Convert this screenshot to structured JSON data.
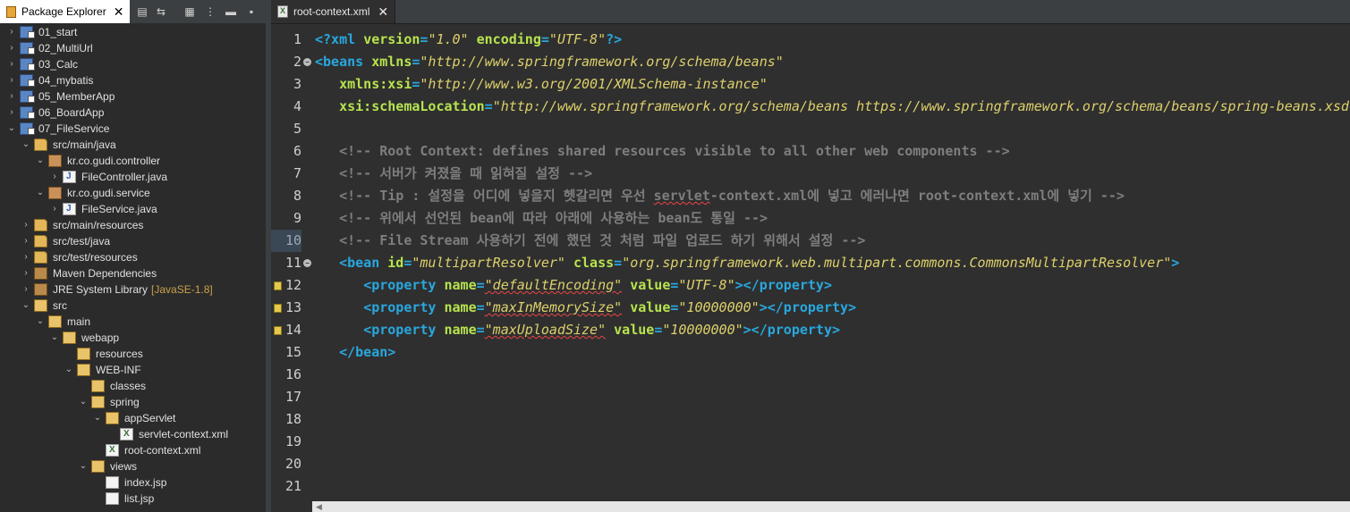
{
  "explorer": {
    "tab_label": "Package Explorer",
    "tree": [
      {
        "label": "01_start",
        "depth": 0,
        "twisty": ">",
        "icon": "project-icon"
      },
      {
        "label": "02_MultiUrl",
        "depth": 0,
        "twisty": ">",
        "icon": "project-icon"
      },
      {
        "label": "03_Calc",
        "depth": 0,
        "twisty": ">",
        "icon": "project-icon"
      },
      {
        "label": "04_mybatis",
        "depth": 0,
        "twisty": ">",
        "icon": "project-icon"
      },
      {
        "label": "05_MemberApp",
        "depth": 0,
        "twisty": ">",
        "icon": "project-icon"
      },
      {
        "label": "06_BoardApp",
        "depth": 0,
        "twisty": ">",
        "icon": "project-icon"
      },
      {
        "label": "07_FileService",
        "depth": 0,
        "twisty": "v",
        "icon": "project-icon"
      },
      {
        "label": "src/main/java",
        "depth": 1,
        "twisty": "v",
        "icon": "source-folder-icon"
      },
      {
        "label": "kr.co.gudi.controller",
        "depth": 2,
        "twisty": "v",
        "icon": "package-icon"
      },
      {
        "label": "FileController.java",
        "depth": 3,
        "twisty": ">",
        "icon": "java-file-icon"
      },
      {
        "label": "kr.co.gudi.service",
        "depth": 2,
        "twisty": "v",
        "icon": "package-icon"
      },
      {
        "label": "FileService.java",
        "depth": 3,
        "twisty": ">",
        "icon": "java-file-icon"
      },
      {
        "label": "src/main/resources",
        "depth": 1,
        "twisty": ">",
        "icon": "source-folder-icon"
      },
      {
        "label": "src/test/java",
        "depth": 1,
        "twisty": ">",
        "icon": "source-folder-icon"
      },
      {
        "label": "src/test/resources",
        "depth": 1,
        "twisty": ">",
        "icon": "source-folder-icon"
      },
      {
        "label": "Maven Dependencies",
        "depth": 1,
        "twisty": ">",
        "icon": "library-icon"
      },
      {
        "label": "JRE System Library",
        "decoration": "[JavaSE-1.8]",
        "depth": 1,
        "twisty": ">",
        "icon": "library-icon"
      },
      {
        "label": "src",
        "depth": 1,
        "twisty": "v",
        "icon": "folder-icon"
      },
      {
        "label": "main",
        "depth": 2,
        "twisty": "v",
        "icon": "folder-icon"
      },
      {
        "label": "webapp",
        "depth": 3,
        "twisty": "v",
        "icon": "folder-icon"
      },
      {
        "label": "resources",
        "depth": 4,
        "twisty": "",
        "icon": "folder-icon"
      },
      {
        "label": "WEB-INF",
        "depth": 4,
        "twisty": "v",
        "icon": "folder-icon"
      },
      {
        "label": "classes",
        "depth": 5,
        "twisty": "",
        "icon": "folder-icon"
      },
      {
        "label": "spring",
        "depth": 5,
        "twisty": "v",
        "icon": "folder-icon"
      },
      {
        "label": "appServlet",
        "depth": 6,
        "twisty": "v",
        "icon": "folder-icon"
      },
      {
        "label": "servlet-context.xml",
        "depth": 7,
        "twisty": "",
        "icon": "xml-file-icon"
      },
      {
        "label": "root-context.xml",
        "depth": 6,
        "twisty": "",
        "icon": "xml-file-icon"
      },
      {
        "label": "views",
        "depth": 5,
        "twisty": "v",
        "icon": "folder-icon"
      },
      {
        "label": "index.jsp",
        "depth": 6,
        "twisty": "",
        "icon": "jsp-file-icon"
      },
      {
        "label": "list.jsp",
        "depth": 6,
        "twisty": "",
        "icon": "jsp-file-icon"
      }
    ]
  },
  "editor": {
    "tab_label": "root-context.xml",
    "current_line": 10,
    "lines": [
      {
        "n": "1",
        "parts": [
          [
            "tag",
            "<?xml "
          ],
          [
            "attr",
            "version"
          ],
          [
            "tag",
            "="
          ],
          [
            "val",
            "\"1.0\""
          ],
          [
            "tag",
            " "
          ],
          [
            "attr",
            "encoding"
          ],
          [
            "tag",
            "="
          ],
          [
            "val",
            "\"UTF-8\""
          ],
          [
            "tag",
            "?>"
          ]
        ]
      },
      {
        "n": "2",
        "fold": true,
        "parts": [
          [
            "tag",
            "<beans "
          ],
          [
            "attr",
            "xmlns"
          ],
          [
            "tag",
            "="
          ],
          [
            "val",
            "\"http://www.springframework.org/schema/beans\""
          ]
        ]
      },
      {
        "n": "3",
        "parts": [
          [
            "txt",
            "   "
          ],
          [
            "attr",
            "xmlns:xsi"
          ],
          [
            "tag",
            "="
          ],
          [
            "val",
            "\"http://www.w3.org/2001/XMLSchema-instance\""
          ]
        ]
      },
      {
        "n": "4",
        "parts": [
          [
            "txt",
            "   "
          ],
          [
            "attr",
            "xsi:schemaLocation"
          ],
          [
            "tag",
            "="
          ],
          [
            "val",
            "\"http://www.springframework.org/schema/beans https://www.springframework.org/schema/beans/spring-beans.xsd\""
          ],
          [
            "tag",
            ">"
          ]
        ]
      },
      {
        "n": "5",
        "parts": []
      },
      {
        "n": "6",
        "parts": [
          [
            "com",
            "   <!-- Root Context: defines shared resources visible to all other web components -->"
          ]
        ]
      },
      {
        "n": "7",
        "parts": [
          [
            "com",
            "   <!-- 서버가 켜졌을 때 읽혀질 설정 -->"
          ]
        ]
      },
      {
        "n": "8",
        "parts": [
          [
            "com",
            "   <!-- Tip : 설정을 어디에 넣을지 헷갈리면 우선 "
          ],
          [
            "comsq",
            "servlet"
          ],
          [
            "com",
            "-context.xml에 넣고 에러나면 root-context.xml에 넣기 -->"
          ]
        ]
      },
      {
        "n": "9",
        "parts": [
          [
            "com",
            "   <!-- 위에서 선언된 bean에 따라 아래에 사용하는 bean도 통일 -->"
          ]
        ]
      },
      {
        "n": "10",
        "parts": [
          [
            "com",
            "   <!-- File Stream 사용하기 전에 했던 것 처럼 파일 업로드 하기 위해서 설정 -->"
          ]
        ]
      },
      {
        "n": "11",
        "fold": true,
        "parts": [
          [
            "txt",
            "   "
          ],
          [
            "tag",
            "<bean "
          ],
          [
            "attr",
            "id"
          ],
          [
            "tag",
            "="
          ],
          [
            "val",
            "\"multipartResolver\""
          ],
          [
            "tag",
            " "
          ],
          [
            "attr",
            "class"
          ],
          [
            "tag",
            "="
          ],
          [
            "val",
            "\"org.springframework.web.multipart.commons.CommonsMultipartResolver\""
          ],
          [
            "tag",
            ">"
          ]
        ]
      },
      {
        "n": "12",
        "mark": true,
        "parts": [
          [
            "txt",
            "      "
          ],
          [
            "tag",
            "<property "
          ],
          [
            "attr",
            "name"
          ],
          [
            "tag",
            "="
          ],
          [
            "valsq",
            "\"defaultEncoding\""
          ],
          [
            "tag",
            " "
          ],
          [
            "attr",
            "value"
          ],
          [
            "tag",
            "="
          ],
          [
            "val",
            "\"UTF-8\""
          ],
          [
            "tag",
            "></property>"
          ]
        ]
      },
      {
        "n": "13",
        "mark": true,
        "parts": [
          [
            "txt",
            "      "
          ],
          [
            "tag",
            "<property "
          ],
          [
            "attr",
            "name"
          ],
          [
            "tag",
            "="
          ],
          [
            "valsq",
            "\"maxInMemorySize\""
          ],
          [
            "tag",
            " "
          ],
          [
            "attr",
            "value"
          ],
          [
            "tag",
            "="
          ],
          [
            "val",
            "\"10000000\""
          ],
          [
            "tag",
            "></property>"
          ]
        ]
      },
      {
        "n": "14",
        "mark": true,
        "parts": [
          [
            "txt",
            "      "
          ],
          [
            "tag",
            "<property "
          ],
          [
            "attr",
            "name"
          ],
          [
            "tag",
            "="
          ],
          [
            "valsq",
            "\"maxUploadSize\""
          ],
          [
            "tag",
            " "
          ],
          [
            "attr",
            "value"
          ],
          [
            "tag",
            "="
          ],
          [
            "val",
            "\"10000000\""
          ],
          [
            "tag",
            "></property>"
          ]
        ]
      },
      {
        "n": "15",
        "parts": [
          [
            "txt",
            "   "
          ],
          [
            "tag",
            "</bean>"
          ]
        ]
      },
      {
        "n": "16",
        "parts": []
      },
      {
        "n": "17",
        "parts": []
      },
      {
        "n": "18",
        "parts": []
      },
      {
        "n": "19",
        "parts": []
      },
      {
        "n": "20",
        "parts": []
      },
      {
        "n": "21",
        "parts": []
      }
    ]
  },
  "colors": {
    "tag": "#29a7de",
    "attribute": "#b6e34e",
    "value": "#ddd06b",
    "comment": "#7e7e7e",
    "editor_background": "#2f2f2f"
  }
}
